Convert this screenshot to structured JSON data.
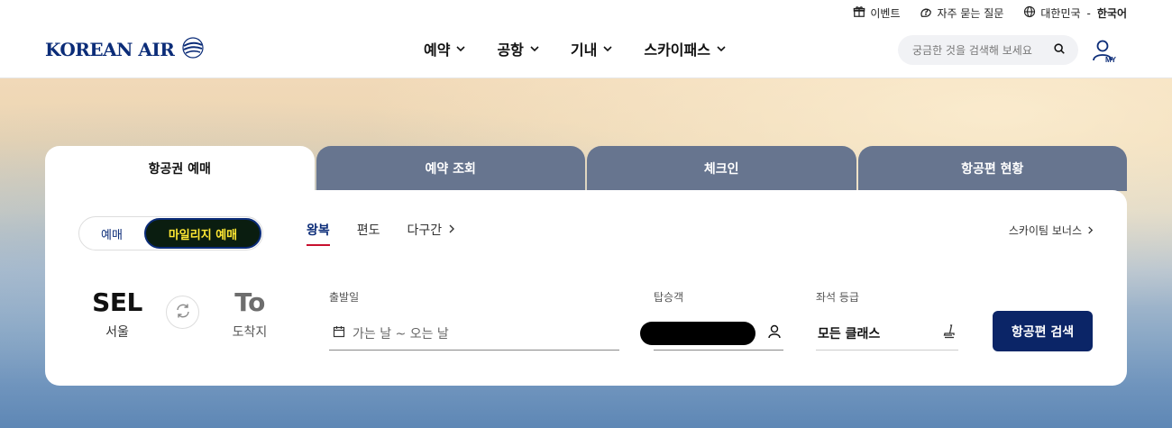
{
  "utility": {
    "event": "이벤트",
    "faq": "자주 묻는 질문",
    "region": "대한민국",
    "separator": "-",
    "language": "한국어"
  },
  "logo": {
    "text": "KOREAN AIR"
  },
  "nav": {
    "items": [
      {
        "label": "예약"
      },
      {
        "label": "공항"
      },
      {
        "label": "기내"
      },
      {
        "label": "스카이패스"
      }
    ]
  },
  "search": {
    "placeholder": "궁금한 것을 검색해 보세요"
  },
  "my": {
    "label": "MY"
  },
  "tabs": [
    {
      "label": "항공권 예매",
      "active": true
    },
    {
      "label": "예약 조회"
    },
    {
      "label": "체크인"
    },
    {
      "label": "항공편 현황"
    }
  ],
  "booking": {
    "toggle": {
      "regular": "예매",
      "mileage": "마일리지 예매",
      "selected": "mileage"
    },
    "trip_types": {
      "round": "왕복",
      "oneway": "편도",
      "multi": "다구간",
      "selected": "round"
    },
    "bonus_link": "스카이팀 보너스",
    "origin": {
      "code": "SEL",
      "name": "서울"
    },
    "destination": {
      "code": "To",
      "name": "도착지"
    },
    "date": {
      "label": "출발일",
      "placeholder": "가는 날 ~ 오는 날"
    },
    "passengers": {
      "label": "탑승객"
    },
    "cabin": {
      "label": "좌석 등급",
      "value": "모든 클래스"
    },
    "search_button": "항공편 검색"
  },
  "colors": {
    "brand_navy": "#0b2c78",
    "tab_inactive": "#67758f",
    "accent_red": "#c8102e",
    "search_button": "#0b2567"
  }
}
